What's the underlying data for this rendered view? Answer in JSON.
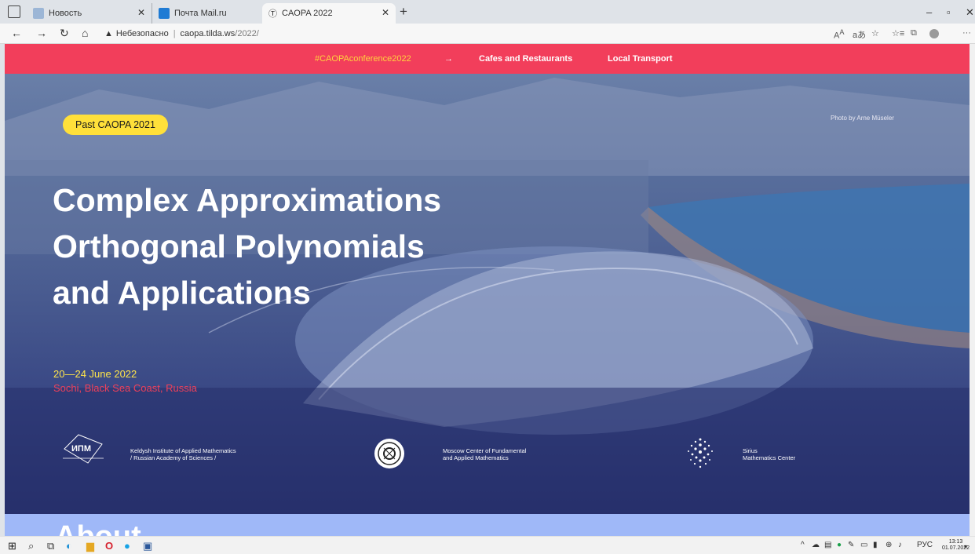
{
  "browser": {
    "tabs": [
      {
        "label": "Новость",
        "color": "#9cb6d6"
      },
      {
        "label": "Почта Mail.ru",
        "color": "#1f7bd4"
      },
      {
        "label": "CAOPA 2022",
        "active": true
      }
    ],
    "address": {
      "warning": "Небезопасно",
      "host": "caopa.tilda.ws",
      "path": "/2022/"
    }
  },
  "nav": {
    "hashtag": "#CAOPAconference2022",
    "arrow": "→",
    "cafes": "Cafes and Restaurants",
    "transport": "Local Transport",
    "color": "#f23e5b"
  },
  "hero": {
    "badge": "Past CAOPA 2021",
    "credit": "Photo by Arne Müseler",
    "title_lines": [
      "Complex Approximations",
      "Orthogonal Polynomials",
      "and Applications"
    ],
    "dates": "20—24 June 2022",
    "place": "Sochi, Black Sea Coast, Russia"
  },
  "partners": [
    {
      "logo_text": "ИПМ",
      "name": "Keldysh Institute of Applied Mathematics\n/ Russian Academy of Sciences /"
    },
    {
      "name": "Moscow Center of Fundamental\nand Applied Mathematics"
    },
    {
      "name": "Sirius\nMathematics Center"
    }
  ],
  "about": {
    "heading": "About"
  },
  "taskbar": {
    "lang": "РУС",
    "time": "13:13",
    "date": "01.07.2022"
  }
}
